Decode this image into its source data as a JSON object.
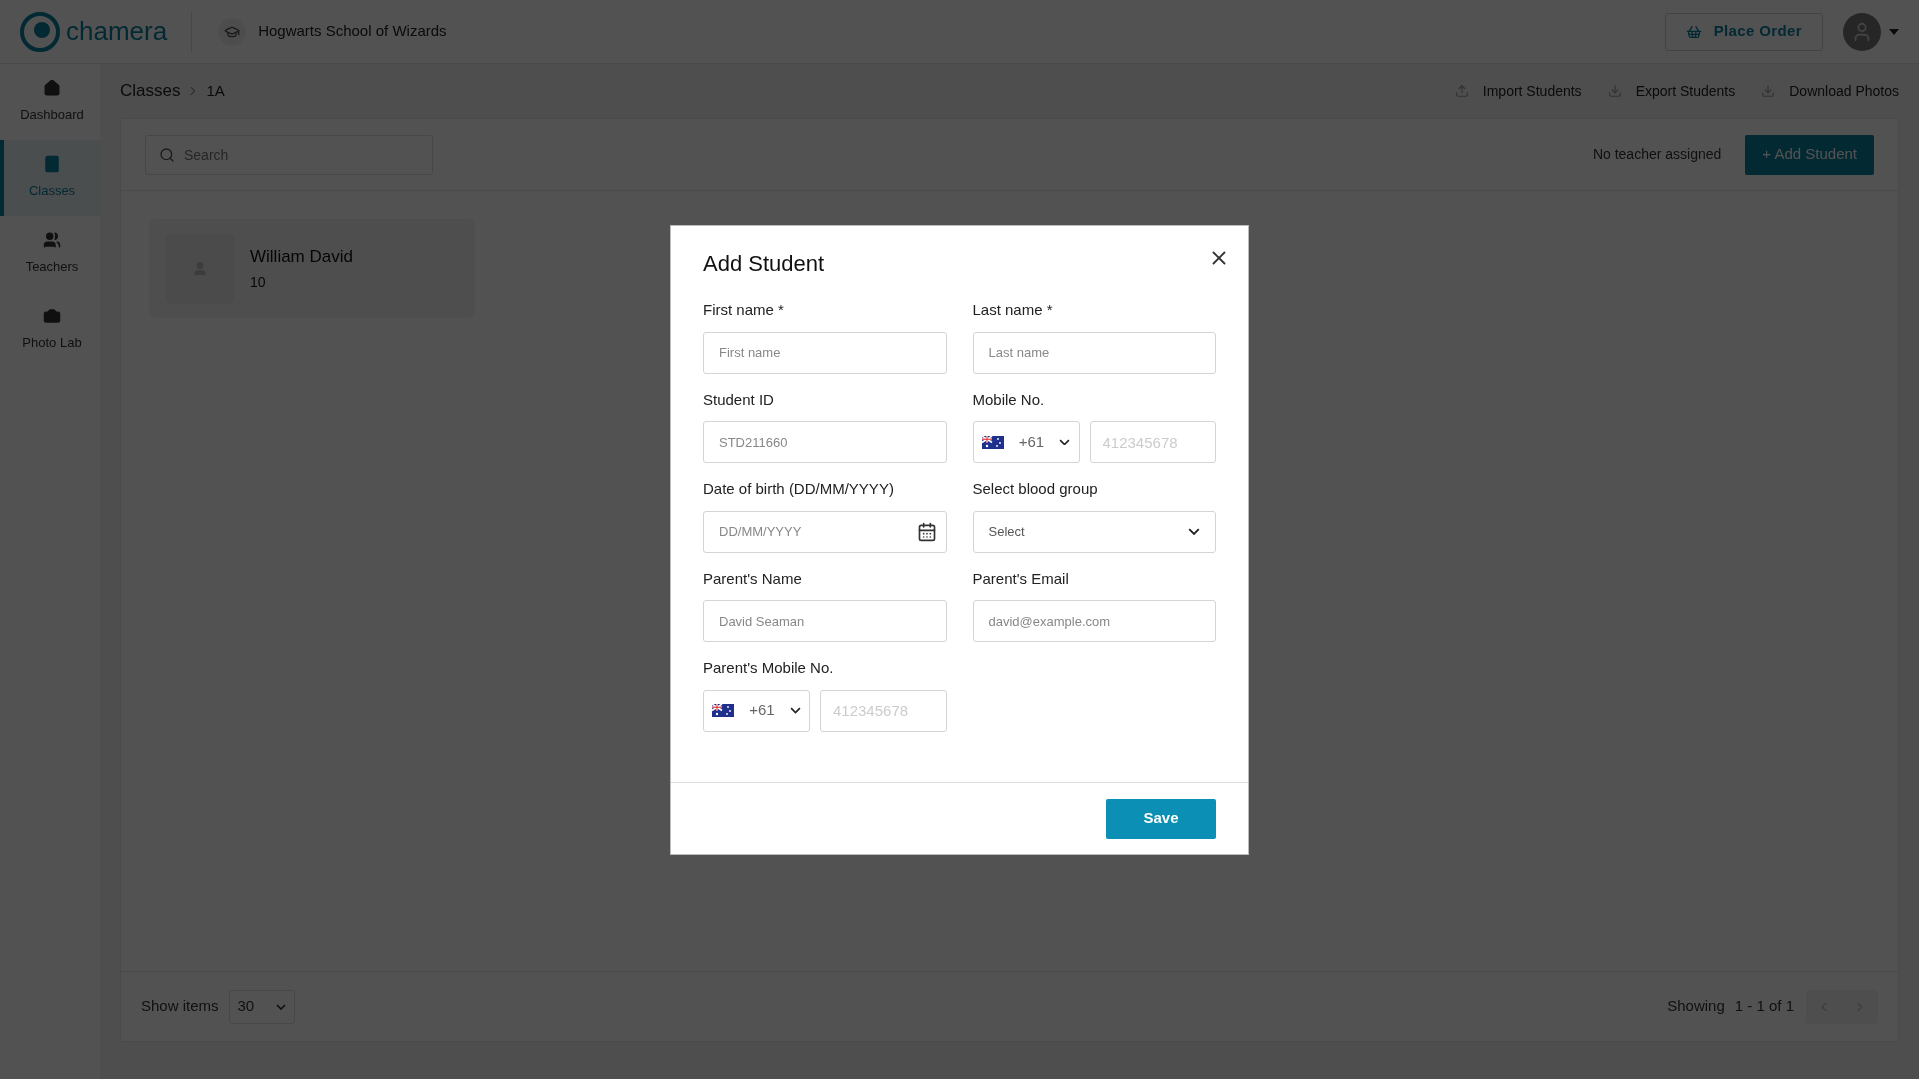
{
  "header": {
    "logo_text": "chamera",
    "school": "Hogwarts School of Wizards",
    "place_order": "Place Order"
  },
  "sidebar": {
    "items": [
      {
        "label": "Dashboard",
        "selected": false
      },
      {
        "label": "Classes",
        "selected": true
      },
      {
        "label": "Teachers",
        "selected": false
      },
      {
        "label": "Photo Lab",
        "selected": false
      }
    ]
  },
  "breadcrumb": [
    "Classes",
    "1A"
  ],
  "actions": [
    {
      "label": "Import Students",
      "kind": "import"
    },
    {
      "label": "Export Students",
      "kind": "export"
    },
    {
      "label": "Download Photos",
      "kind": "export"
    }
  ],
  "search": {
    "placeholder": "Search"
  },
  "teacher_note": "No teacher assigned",
  "add_button": "+ Add Student",
  "students": [
    {
      "name": "William David",
      "detail": "10"
    }
  ],
  "footer": {
    "show_items_label": "Show items",
    "page_size": "30",
    "showing_label": "Showing",
    "range": "1 - 1 of 1"
  },
  "modal": {
    "title": "Add Student",
    "save": "Save",
    "fields": [
      {
        "kind": "text",
        "label": "First name *",
        "placeholder": "First name"
      },
      {
        "kind": "text",
        "label": "Last name *",
        "placeholder": "Last name"
      },
      {
        "kind": "text",
        "label": "Student ID",
        "placeholder": "STD211660"
      },
      {
        "kind": "phone",
        "label": "Mobile No.",
        "code": "+61",
        "placeholder": "412345678"
      },
      {
        "kind": "date",
        "label": "Date of birth (DD/MM/YYYY)",
        "placeholder": "DD/MM/YYYY"
      },
      {
        "kind": "select",
        "label": "Select blood group",
        "value": "Select"
      },
      {
        "kind": "text",
        "label": "Parent's Name",
        "placeholder": "David Seaman"
      },
      {
        "kind": "text",
        "label": "Parent's Email",
        "placeholder": "david@example.com"
      },
      {
        "kind": "phone",
        "label": "Parent's Mobile No.",
        "code": "+61",
        "placeholder": "412345678"
      }
    ]
  }
}
